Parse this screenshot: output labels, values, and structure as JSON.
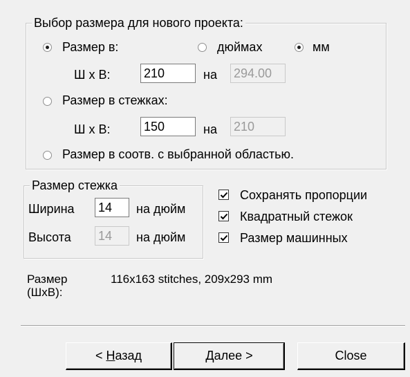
{
  "project_size": {
    "legend": "Выбор размера для нового проекта:",
    "size_in_label": "Размер в:",
    "inches_label": "дюймах",
    "mm_label": "мм",
    "wxh_label": "Ш x В:",
    "width_value": "210",
    "on_label": "на",
    "height_value": "294.00",
    "stitches_label": "Размер в стежках:",
    "wxh_label2": "Ш x В:",
    "stitch_width_value": "150",
    "on_label2": "на",
    "stitch_height_value": "210",
    "selection_label": "Размер в соотв. с выбранной областью."
  },
  "stitch_size": {
    "legend": "Размер стежка",
    "width_label": "Ширина",
    "width_value": "14",
    "per_inch_label": "на дюйм",
    "height_label": "Высота",
    "height_value": "14",
    "per_inch_label2": "на дюйм"
  },
  "options": {
    "keep_proportions": "Сохранять пропорции",
    "square_stitch": "Квадратный стежок",
    "machine_size": "Размер машинных"
  },
  "summary": {
    "label_line1": "Размер",
    "label_line2": "(ШxВ):",
    "value": "116x163 stitches,  209x293 mm"
  },
  "buttons": {
    "back_prefix": "< ",
    "back_hotkey": "Н",
    "back_rest": "азад",
    "next_hotkey": "Д",
    "next_rest": "алее >",
    "close": "Close"
  }
}
